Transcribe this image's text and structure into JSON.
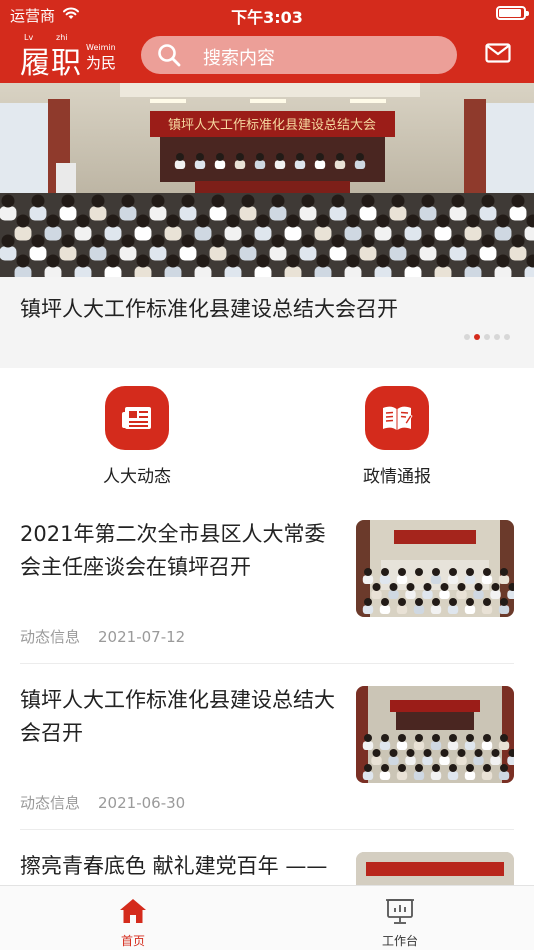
{
  "status_bar": {
    "carrier": "运营商",
    "time": "下午3:03",
    "battery_level": 0.9
  },
  "app_bar": {
    "logo": {
      "text": "履职",
      "text_pinyin_1": "Lv",
      "text_pinyin_2": "zhi",
      "sub_pinyin": "Weimin",
      "sub_text": "为民"
    },
    "search_placeholder": "搜索内容",
    "icons": {
      "search": "search-icon",
      "mail": "mail-icon"
    }
  },
  "banner": {
    "caption": "镇坪人大工作标准化县建设总结大会召开",
    "photo_sign_text": "镇坪人大工作标准化县建设总结大会",
    "page_count": 5,
    "active_index": 1
  },
  "quick_nav": [
    {
      "label": "人大动态",
      "icon": "newspaper-icon"
    },
    {
      "label": "政情通报",
      "icon": "open-book-icon"
    }
  ],
  "news": [
    {
      "title": "2021年第二次全市县区人大常委会主任座谈会在镇坪召开",
      "category": "动态信息",
      "date": "2021-07-12"
    },
    {
      "title": "镇坪人大工作标准化县建设总结大会召开",
      "category": "动态信息",
      "date": "2021-06-30"
    },
    {
      "title": "擦亮青春底色 献礼建党百年 ——",
      "category": "",
      "date": ""
    }
  ],
  "tab_bar": [
    {
      "label": "首页",
      "icon": "home-icon",
      "active": true
    },
    {
      "label": "工作台",
      "icon": "dashboard-icon",
      "active": false
    }
  ],
  "colors": {
    "brand": "#d42b1c",
    "text": "#222222",
    "muted": "#9a9a9a",
    "tab_inactive": "#333333"
  }
}
